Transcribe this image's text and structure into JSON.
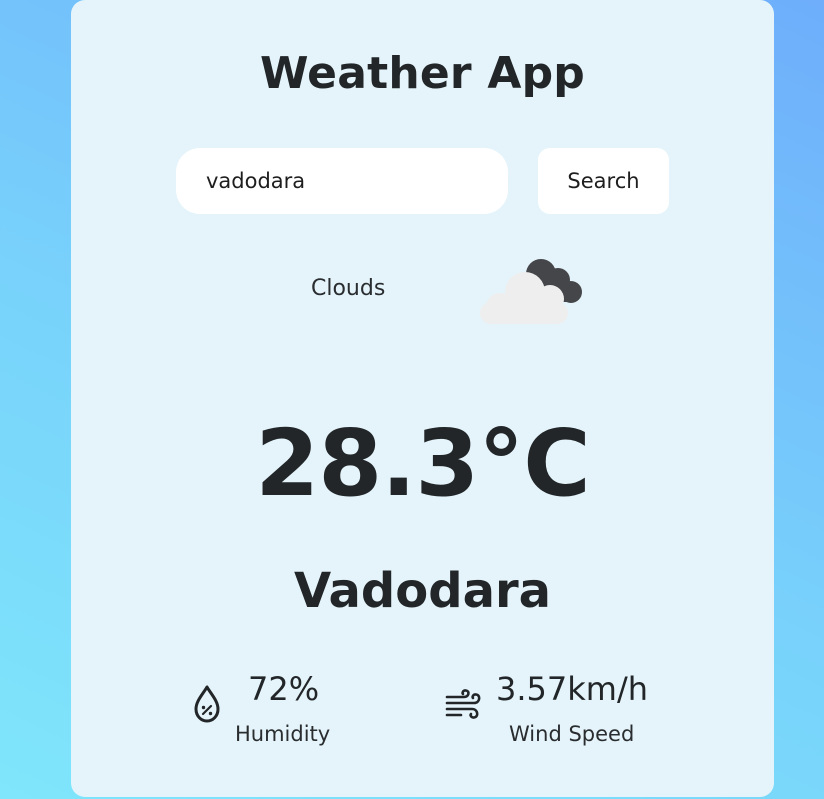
{
  "app": {
    "title": "Weather App"
  },
  "search": {
    "value": "vadodara",
    "placeholder": "",
    "button_label": "Search"
  },
  "weather": {
    "condition": "Clouds",
    "icon": "clouds-icon",
    "temperature": "28.3°C",
    "city": "Vadodara"
  },
  "stats": {
    "humidity": {
      "value": "72%",
      "label": "Humidity",
      "icon": "humidity-drop-icon"
    },
    "wind": {
      "value": "3.57km/h",
      "label": "Wind Speed",
      "icon": "wind-icon"
    }
  },
  "colors": {
    "background_top": "#6eaefb",
    "background_bottom": "#7fe6fb",
    "card": "#e4f4fa",
    "text": "#222629"
  }
}
